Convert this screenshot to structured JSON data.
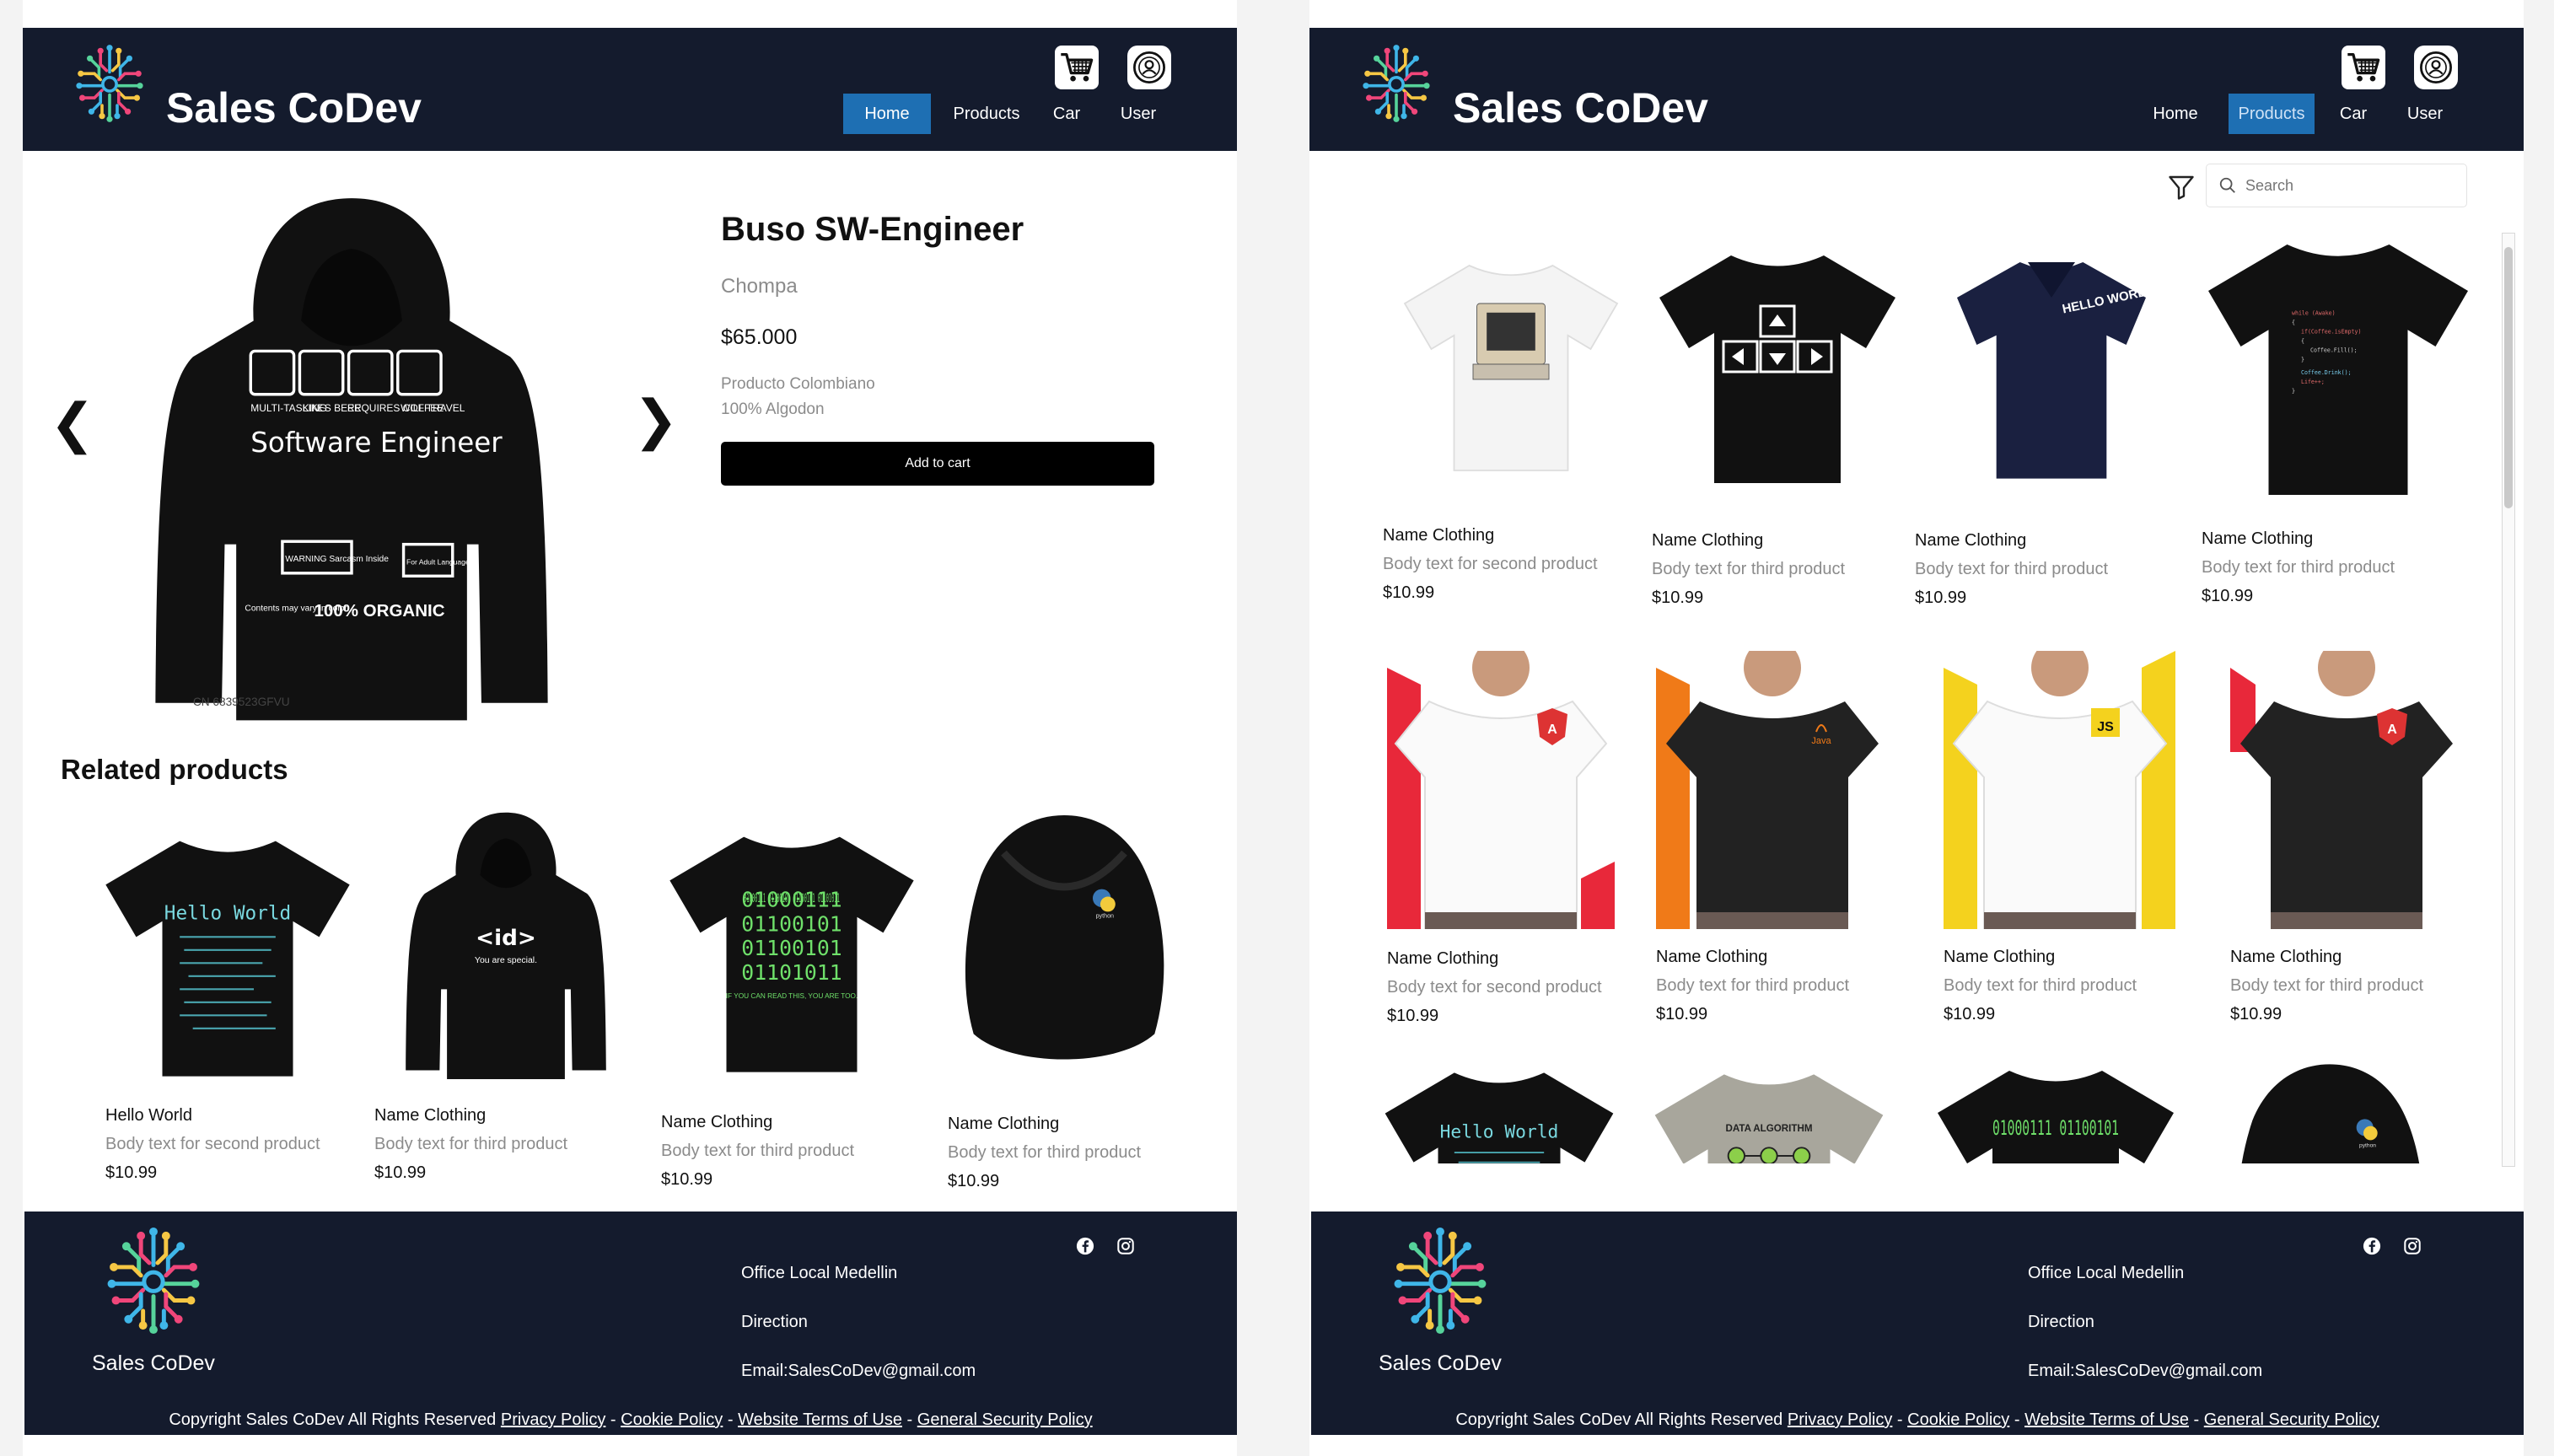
{
  "brand": "Sales CoDev",
  "nav": {
    "home": "Home",
    "products": "Products",
    "car": "Car",
    "user": "User"
  },
  "detail": {
    "title": "Buso SW-Engineer",
    "category": "Chompa",
    "price": "$65.000",
    "desc1": "Producto Colombiano",
    "desc2": "100% Algodon",
    "add_to_cart": "Add to cart",
    "related_title": "Related products",
    "hoodie_print": {
      "icons": [
        "MULTI-TASKING",
        "LIKES BEER",
        "REQUIRES COFFEE",
        "WILL TRAVEL"
      ],
      "main": "Software Engineer",
      "warning": "WARNING Sarcasm Inside",
      "contents": "Contents may vary in color",
      "organic": "100% ORGANIC",
      "rating": "For Adult Language",
      "code": "CN 6839523GFVU"
    }
  },
  "related": [
    {
      "name": "Hello World",
      "body": "Body text for second product",
      "price": "$10.99",
      "print": "Hello World"
    },
    {
      "name": "Name Clothing",
      "body": "Body text for third product",
      "price": "$10.99",
      "print": "<id>",
      "print2": "You are special."
    },
    {
      "name": "Name Clothing",
      "body": "Body text for third product",
      "price": "$10.99",
      "print": "01000111 01100101 01100101 01101011",
      "print2": "IF YOU CAN READ THIS, YOU ARE TOO."
    },
    {
      "name": "Name Clothing",
      "body": "Body text for third product",
      "price": "$10.99",
      "print": "python"
    }
  ],
  "search": {
    "placeholder": "Search"
  },
  "grid_row1": [
    {
      "name": "Name Clothing",
      "body": "Body text for second product",
      "price": "$10.99"
    },
    {
      "name": "Name Clothing",
      "body": "Body text for third product",
      "price": "$10.99"
    },
    {
      "name": "Name Clothing",
      "body": "Body text for third product",
      "price": "$10.99",
      "print": "HELLO WORLD"
    },
    {
      "name": "Name Clothing",
      "body": "Body text for third product",
      "price": "$10.99",
      "code": [
        "while (Awake)",
        "{",
        "if(Coffee.isEmpty)",
        "{",
        "Coffee.Fill();",
        "}",
        "Coffee.Drink();",
        "Life++;",
        "}"
      ]
    }
  ],
  "grid_row2": [
    {
      "name": "Name Clothing",
      "body": "Body text for second product",
      "price": "$10.99",
      "badge": "A"
    },
    {
      "name": "Name Clothing",
      "body": "Body text for third product",
      "price": "$10.99",
      "badge": "Java"
    },
    {
      "name": "Name Clothing",
      "body": "Body text for third product",
      "price": "$10.99",
      "badge": "JS"
    },
    {
      "name": "Name Clothing",
      "body": "Body text for third product",
      "price": "$10.99",
      "badge": "A"
    }
  ],
  "grid_row3": [
    {
      "print": "Hello World"
    },
    {
      "print": "DATA ALGORITHM"
    },
    {
      "print": "01000111 01100101"
    },
    {
      "print": "python"
    }
  ],
  "footer": {
    "brand": "Sales CoDev",
    "office": "Office Local Medellin",
    "direction": "Direction",
    "email": "Email:SalesCoDev@gmail.com",
    "copyright_prefix": "Copyright Sales CoDev All Rights Reserved ",
    "privacy": "Privacy Policy",
    "cookie": "Cookie Policy",
    "terms": "Website Terms of Use",
    "security": "General Security Policy",
    "sep": " - "
  },
  "colors": {
    "header_bg": "#141b2d",
    "nav_active": "#1e6fb3",
    "button_bg": "#000000"
  }
}
